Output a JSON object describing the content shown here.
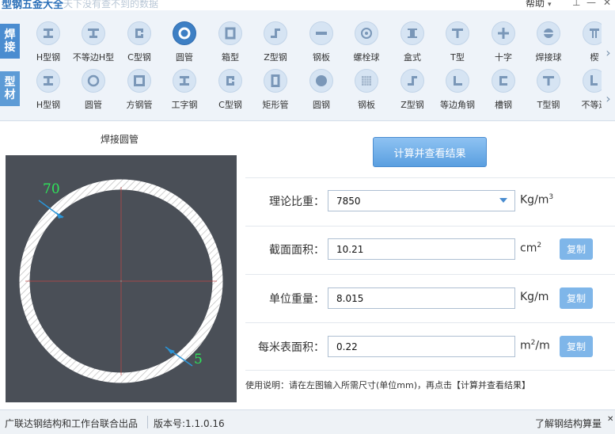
{
  "app": {
    "title": "型钢五金大全",
    "subtitle": "天下没有查不到的数据",
    "help_label": "帮助",
    "help_arrow": "▾",
    "pin_glyph": "⊥",
    "min_glyph": "—",
    "close_glyph": "✕"
  },
  "toolbar": {
    "weld_tab": [
      "焊",
      "接"
    ],
    "profile_tab": [
      "型",
      "材"
    ],
    "scroll_glyph": "›",
    "weld_items": [
      {
        "label": "H型钢",
        "icon": "i-beam-icon"
      },
      {
        "label": "不等边H型",
        "icon": "unequal-i-beam-icon"
      },
      {
        "label": "C型钢",
        "icon": "c-channel-icon"
      },
      {
        "label": "圆管",
        "icon": "round-tube-icon",
        "active": true
      },
      {
        "label": "箱型",
        "icon": "box-section-icon"
      },
      {
        "label": "Z型钢",
        "icon": "z-section-icon"
      },
      {
        "label": "钢板",
        "icon": "steel-plate-icon"
      },
      {
        "label": "螺栓球",
        "icon": "bolt-ball-icon"
      },
      {
        "label": "盒式",
        "icon": "box-type-icon"
      },
      {
        "label": "T型",
        "icon": "t-section-icon"
      },
      {
        "label": "十字",
        "icon": "cross-section-icon"
      },
      {
        "label": "焊接球",
        "icon": "welded-ball-icon"
      },
      {
        "label": "楔",
        "icon": "wedge-icon"
      }
    ],
    "profile_items": [
      {
        "label": "H型钢",
        "icon": "i-beam-icon"
      },
      {
        "label": "圆管",
        "icon": "round-tube-icon"
      },
      {
        "label": "方钢管",
        "icon": "square-tube-icon"
      },
      {
        "label": "工字钢",
        "icon": "i-steel-icon"
      },
      {
        "label": "C型钢",
        "icon": "c-channel-icon"
      },
      {
        "label": "矩形管",
        "icon": "rect-tube-icon"
      },
      {
        "label": "圆钢",
        "icon": "round-bar-icon"
      },
      {
        "label": "钢板",
        "icon": "steel-plate-icon"
      },
      {
        "label": "Z型钢",
        "icon": "z-section-icon"
      },
      {
        "label": "等边角钢",
        "icon": "equal-angle-icon"
      },
      {
        "label": "槽钢",
        "icon": "channel-icon"
      },
      {
        "label": "T型钢",
        "icon": "t-section-icon"
      },
      {
        "label": "不等边",
        "icon": "unequal-angle-icon"
      }
    ]
  },
  "drawing": {
    "title": "焊接圆管",
    "outer_label": "70",
    "thickness_label": "5"
  },
  "calc": {
    "button_label": "计算并查看结果",
    "copy_label": "复制",
    "density": {
      "label": "理论比重：",
      "value": "7850",
      "unit": "Kg/m",
      "unit_sup": "3"
    },
    "area": {
      "label": "截面面积：",
      "value": "10.21",
      "unit": "cm",
      "unit_sup": "2"
    },
    "weight": {
      "label": "单位重量：",
      "value": "8.015",
      "unit": "Kg/m"
    },
    "surface": {
      "label": "每米表面积：",
      "value": "0.22",
      "unit_pre": "m",
      "unit_sup": "2",
      "unit_post": "/m"
    },
    "instructions": "使用说明：请在左图输入所需尺寸(单位mm)，再点击【计算并查看结果】"
  },
  "status": {
    "publisher": "广联达钢结构和工作台联合出品",
    "version": "版本号:1.1.0.16",
    "link": "了解钢结构算量",
    "close_glyph": "✕"
  },
  "colors": {
    "accent": "#4a8cd0",
    "drawing_bg": "#4a4f57",
    "dimension_text": "#2ee65a",
    "copy_button": "#7fb6e9"
  }
}
